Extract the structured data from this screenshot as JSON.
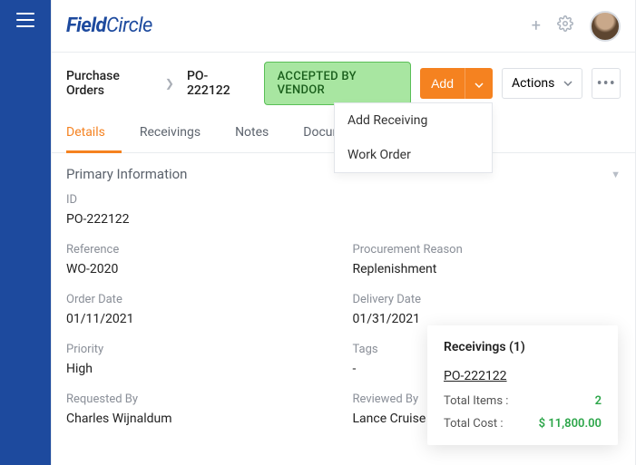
{
  "logo": {
    "bold": "Field",
    "light": "Circle"
  },
  "breadcrumb": {
    "parent": "Purchase Orders",
    "current": "PO-222122"
  },
  "status": "ACCEPTED BY VENDOR",
  "addButton": "Add",
  "actionsButton": "Actions",
  "dropdown": {
    "addReceiving": "Add Receiving",
    "workOrder": "Work Order"
  },
  "tabs": {
    "details": "Details",
    "receivings": "Receivings",
    "notes": "Notes",
    "documents": "Documents"
  },
  "panelTitle": "Primary Information",
  "fields": {
    "id": {
      "label": "ID",
      "value": "PO-222122"
    },
    "reference": {
      "label": "Reference",
      "value": "WO-2020"
    },
    "procurementReason": {
      "label": "Procurement Reason",
      "value": "Replenishment"
    },
    "orderDate": {
      "label": "Order Date",
      "value": "01/11/2021"
    },
    "deliveryDate": {
      "label": "Delivery Date",
      "value": "01/31/2021"
    },
    "priority": {
      "label": "Priority",
      "value": "High"
    },
    "tags": {
      "label": "Tags",
      "value": "-"
    },
    "requestedBy": {
      "label": "Requested By",
      "value": "Charles Wijnaldum"
    },
    "reviewedBy": {
      "label": "Reviewed By",
      "value": "Lance Cruise"
    }
  },
  "popover": {
    "title": "Receivings (1)",
    "link": "PO-222122",
    "totalItemsLabel": "Total Items :",
    "totalItemsValue": "2",
    "totalCostLabel": "Total Cost :",
    "totalCostValue": "$ 11,800.00"
  }
}
